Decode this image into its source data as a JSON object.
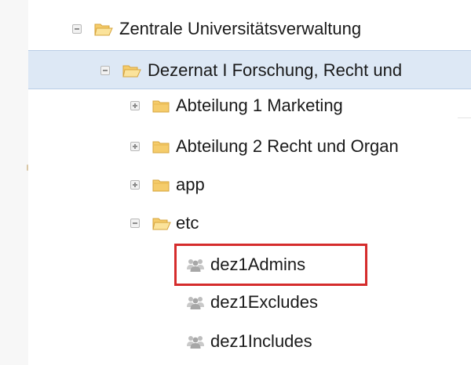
{
  "tree": {
    "items": [
      {
        "label": "Zentrale Universitätsverwaltung",
        "type": "folder",
        "state": "expanded"
      },
      {
        "label": "Dezernat I Forschung, Recht und",
        "type": "folder",
        "state": "expanded",
        "selected": true
      },
      {
        "label": "Abteilung 1 Marketing",
        "type": "folder",
        "state": "collapsed"
      },
      {
        "label": "Abteilung 2 Recht und Organ",
        "type": "folder",
        "state": "collapsed"
      },
      {
        "label": "app",
        "type": "folder",
        "state": "collapsed"
      },
      {
        "label": "etc",
        "type": "folder",
        "state": "expanded"
      },
      {
        "label": "dez1Admins",
        "type": "group",
        "highlighted": true
      },
      {
        "label": "dez1Excludes",
        "type": "group"
      },
      {
        "label": "dez1Includes",
        "type": "group"
      }
    ]
  },
  "icons": {
    "expand": "plus-box-icon",
    "collapse": "minus-box-icon",
    "folder_open": "folder-open-icon",
    "folder_closed": "folder-icon",
    "group": "group-icon"
  },
  "colors": {
    "selection_bg": "#dde8f5",
    "folder": "#f5cc6b",
    "folder_outline": "#d6a43d",
    "highlight_border": "#d52c2c",
    "group_icon": "#a7a7a7"
  }
}
